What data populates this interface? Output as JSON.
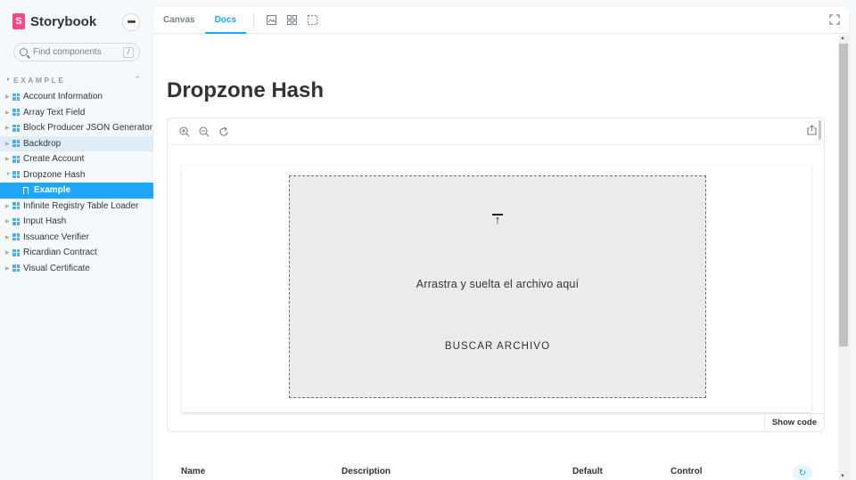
{
  "brand": {
    "name": "Storybook",
    "logo_letter": "S"
  },
  "search": {
    "placeholder": "Find components",
    "shortcut": "/"
  },
  "sidebar": {
    "group": "EXAMPLE",
    "items": [
      {
        "label": "Account Information",
        "state": "normal"
      },
      {
        "label": "Array Text Field",
        "state": "normal"
      },
      {
        "label": "Block Producer JSON Generator",
        "state": "normal"
      },
      {
        "label": "Backdrop",
        "state": "hover"
      },
      {
        "label": "Create Account",
        "state": "normal"
      },
      {
        "label": "Dropzone Hash",
        "state": "expanded"
      },
      {
        "label": "Example",
        "state": "selected"
      },
      {
        "label": "Infinite Registry Table Loader",
        "state": "normal"
      },
      {
        "label": "Input Hash",
        "state": "normal"
      },
      {
        "label": "Issuance Verifier",
        "state": "normal"
      },
      {
        "label": "Ricardian Contract",
        "state": "normal"
      },
      {
        "label": "Visual Certificate",
        "state": "normal"
      }
    ]
  },
  "toolbar": {
    "tabs": [
      {
        "label": "Canvas",
        "active": false
      },
      {
        "label": "Docs",
        "active": true
      }
    ],
    "icons": [
      "image-icon",
      "grid-icon",
      "outline-icon"
    ],
    "fullscreen_icon": "fullscreen-icon"
  },
  "docs": {
    "title": "Dropzone Hash",
    "preview_tools": [
      "zoom-in-icon",
      "zoom-out-icon",
      "zoom-reset-icon"
    ],
    "share_icon": "share-icon",
    "dropzone": {
      "text": "Arrastra y suelta el archivo aquí",
      "button": "BUSCAR ARCHIVO",
      "icon": "upload-icon"
    },
    "show_code": "Show code",
    "args_table": {
      "columns": [
        "Name",
        "Description",
        "Default",
        "Control"
      ],
      "reset_icon": "reset-icon"
    }
  },
  "colors": {
    "accent": "#1ea7fd",
    "brand": "#ff4785",
    "dropzone_bg": "#ebebeb"
  }
}
